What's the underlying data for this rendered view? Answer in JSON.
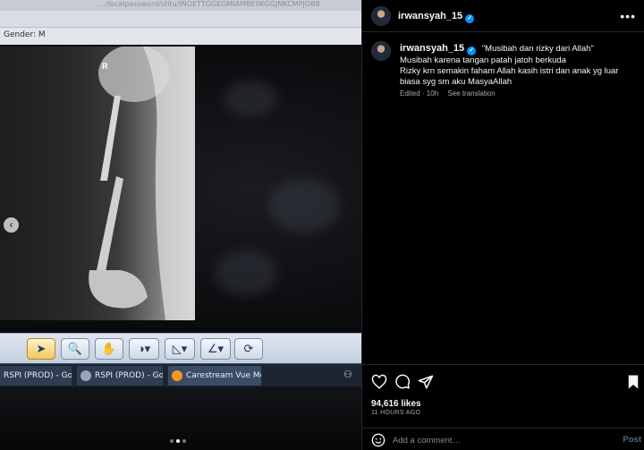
{
  "photo": {
    "url_fragment": "…/localpassword/stitu/INOETTGGEGMIAMBEIIKGGJNKCMPJOBB",
    "gender_label": "Gender:",
    "gender_value": "M",
    "side_marker": "R",
    "toolbar_icons": [
      "pointer-icon",
      "zoom-icon",
      "hand-icon",
      "contrast-icon",
      "measure-icon",
      "angle-icon",
      "rotate-icon"
    ],
    "taskbar": [
      {
        "label": "RSPI (PROD) - Goo…",
        "color": "#3b78e7"
      },
      {
        "label": "RSPI (PROD) - Goo…",
        "color": "#9aa4b2"
      },
      {
        "label": "Carestream Vue Mo…",
        "color": "#f39a1e"
      }
    ],
    "carousel_total": 3,
    "carousel_active": 2
  },
  "post": {
    "username": "irwansyah_15",
    "verified": true,
    "caption_line1": "\"Musibah dan rizky dari Allah\"",
    "caption_line2": "Musibah karena tangan patah jatoh berkuda",
    "caption_line3": "Rizky krn semakin faham Allah kasih istri dan anak yg luar biasa syg sm aku MasyaAllah",
    "edited": "Edited · 10h",
    "see_translation": "See translation",
    "likes": "94,616 likes",
    "time_ago": "11 HOURS AGO",
    "comment_placeholder": "Add a comment…",
    "post_button": "Post",
    "accent_color": "#0095f6"
  }
}
